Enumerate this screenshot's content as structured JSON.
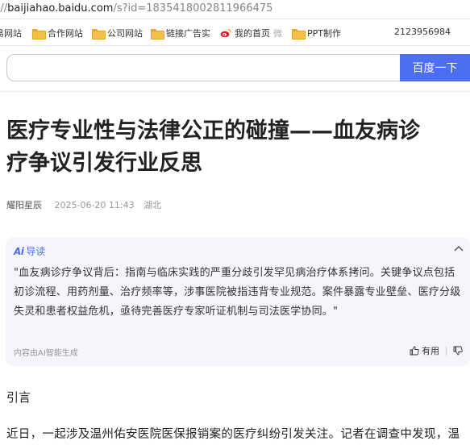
{
  "browser": {
    "url_host": "baijiahao.baidu.com",
    "url_path": "/s?id=1835418002811966475",
    "url_prefix": "://"
  },
  "bookmarks": {
    "items": [
      {
        "label": "易网站",
        "icon": "folder-icon"
      },
      {
        "label": "合作网站",
        "icon": "folder-icon"
      },
      {
        "label": "公司网站",
        "icon": "folder-icon"
      },
      {
        "label": "链接广告实",
        "icon": "folder-icon"
      },
      {
        "label": "我的首页",
        "icon": "weibo-icon"
      },
      {
        "label": "微",
        "icon": ""
      },
      {
        "label": "PPT制作",
        "icon": "folder-icon"
      }
    ],
    "number": "2123956984"
  },
  "search": {
    "placeholder": "",
    "button_label": "百度一下"
  },
  "article": {
    "title_line1": "医疗专业性与法律公正的碰撞——血友病诊",
    "title_line2": "疗争议引发行业反思",
    "author": "耀阳星辰",
    "time": "2025-06-20 11:43",
    "location": "湖北",
    "section_heading": "引言",
    "first_line": "近日，一起涉及温州佑安医院医保报销案的医疗纠纷引发关注。记者在调查中发现，温"
  },
  "ai_guide": {
    "logo": "Ai",
    "label": "导读",
    "summary": "\"血友病诊疗争议背后：指南与临床实践的严重分歧引发罕见病治疗体系拷问。关键争议点包括初诊流程、用药剂量、治疗频率等，涉事医院被指违背专业规范。案件暴露专业壁垒、医疗分级失灵和患者权益危机，亟待完善医疗专家听证机制与司法医学协同。\"",
    "footer": "内容由AI智能生成",
    "useful_label": "有用"
  },
  "colors": {
    "accent": "#4e6ef2",
    "card_bg": "#f5f6fa"
  }
}
